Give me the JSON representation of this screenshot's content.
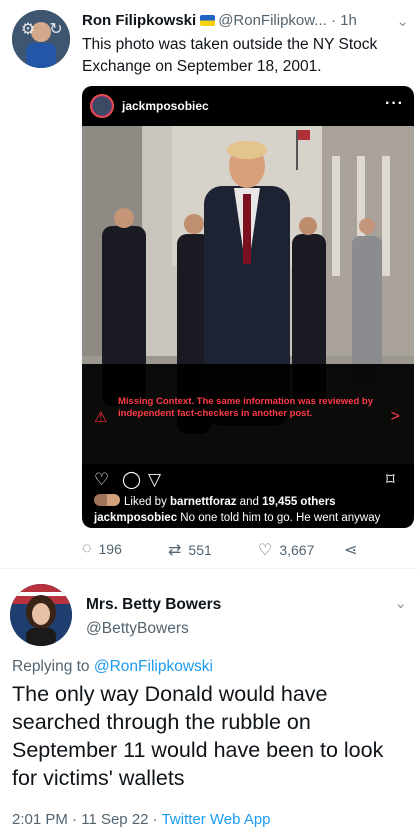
{
  "tweet1": {
    "display_name": "Ron Filipkowski",
    "handle": "@RonFilipkow...",
    "separator": "·",
    "time": "1h",
    "text": "This photo was taken outside the NY Stock Exchange on September 18, 2001.",
    "more_icon": "chevron-down-icon",
    "embed": {
      "username": "jackmposobiec",
      "dots": "···",
      "warning": "Missing Context. The same information was reviewed by independent fact-checkers in another post.",
      "warning_arrow": ">",
      "liked_by_prefix": "Liked by ",
      "liked_by_user": "barnettforaz",
      "liked_by_and": " and ",
      "liked_by_others": "19,455 others",
      "caption_user": "jackmposobiec",
      "caption_text": "No one told him to go. He went anyway"
    },
    "actions": {
      "replies": "196",
      "retweets": "551",
      "likes": "3,667"
    }
  },
  "tweet2": {
    "display_name": "Mrs. Betty Bowers",
    "handle": "@BettyBowers",
    "replying_prefix": "Replying to ",
    "replying_to": "@RonFilipkowski",
    "text": "The only way Donald would have searched through the rubble on September 11 would have been to look for victims' wallets",
    "time": "2:01 PM",
    "date": "11 Sep 22",
    "source": "Twitter Web App",
    "separator": "·"
  },
  "colors": {
    "link": "#1d9bf0",
    "secondary_text": "#536471",
    "warning_red": "#ff3b48",
    "embed_bg": "#000000"
  }
}
